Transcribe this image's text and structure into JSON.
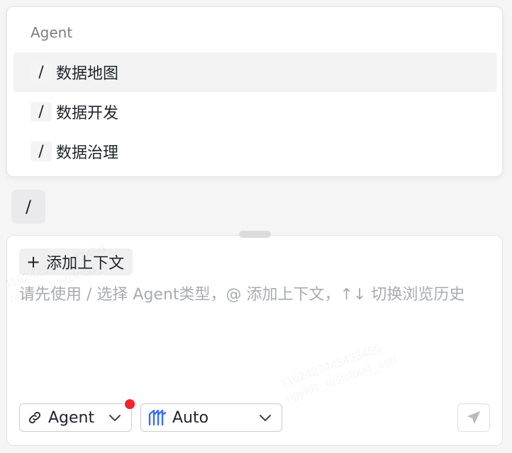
{
  "popover": {
    "title": "Agent",
    "items": [
      {
        "slash": "/",
        "label": "数据地图",
        "active": true
      },
      {
        "slash": "/",
        "label": "数据开发",
        "active": false
      },
      {
        "slash": "/",
        "label": "数据治理",
        "active": false
      }
    ]
  },
  "typed_chip": "/",
  "input": {
    "add_context_icon": "+",
    "add_context_label": "添加上下文",
    "placeholder": "请先使用 / 选择 Agent类型，@ 添加上下文，↑↓ 切换浏览历史"
  },
  "toolbar": {
    "agent_select": {
      "value": "Agent",
      "icon": "agent-link-icon",
      "has_notification": true
    },
    "model_select": {
      "value": "Auto",
      "icon": "model-logo-icon"
    },
    "send_icon": "send-icon"
  },
  "watermark": {
    "line1": "1162423445433459",
    "line2": "ngyi01_testcloud_con"
  },
  "colors": {
    "accent_blue": "#3b6ef5",
    "notification_red": "#f5222d",
    "placeholder_gray": "#a8abb2"
  }
}
